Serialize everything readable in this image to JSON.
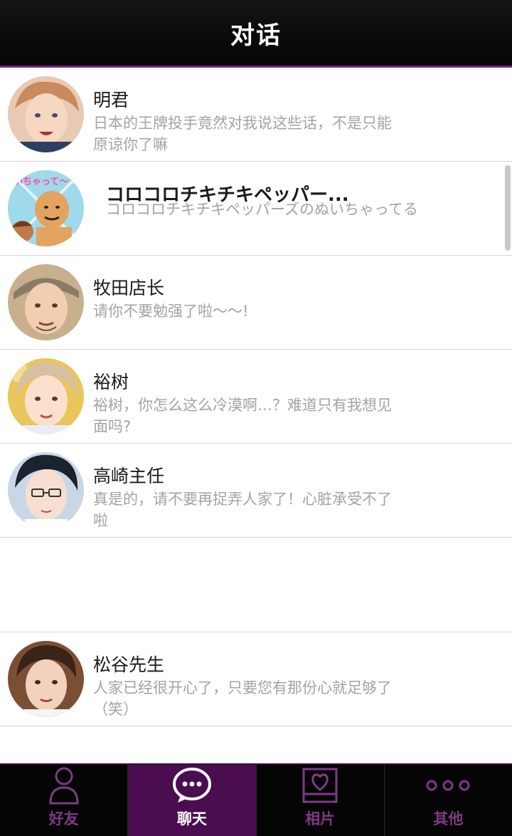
{
  "header": {
    "title": "对话"
  },
  "conversations": [
    {
      "name": "明君",
      "message": "日本的王牌投手竟然对我说这些话，不是只能原谅你了嘛"
    },
    {
      "name": "コロコロチキチキペッパー...",
      "message": "コロコロチキチキペッパーズのぬいちゃってる",
      "badge": "いちゃって〜"
    },
    {
      "name": "牧田店长",
      "message": "请你不要勉强了啦～～!"
    },
    {
      "name": "裕树",
      "message": "裕树，你怎么这么冷漠啊…？难道只有我想见面吗?"
    },
    {
      "name": "高崎主任",
      "message": "真是的，请不要再捉弄人家了！心脏承受不了啦"
    },
    {
      "name": "松谷先生",
      "message": "人家已经很开心了，只要您有那份心就足够了（笑）"
    }
  ],
  "tabs": [
    {
      "label": "好友",
      "icon": "person-icon",
      "active": false
    },
    {
      "label": "聊天",
      "icon": "chat-bubble-icon",
      "active": true
    },
    {
      "label": "相片",
      "icon": "heart-photo-icon",
      "active": false
    },
    {
      "label": "其他",
      "icon": "more-dots-icon",
      "active": false
    }
  ],
  "colors": {
    "accent": "#7a1f82",
    "tab_active": "#4a0d50",
    "secondary_text": "#a3a3a3"
  }
}
